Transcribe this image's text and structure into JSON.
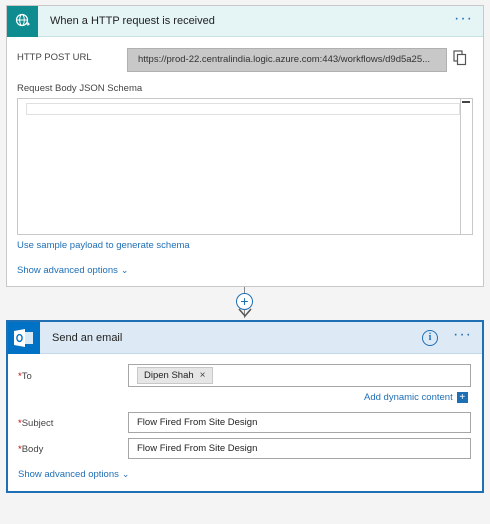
{
  "http_card": {
    "title": "When a HTTP request is received",
    "post_url_label": "HTTP POST URL",
    "post_url_value": "https://prod-22.centralindia.logic.azure.com:443/workflows/d9d5a25...",
    "schema_label": "Request Body JSON Schema",
    "sample_payload_link": "Use sample payload to generate schema",
    "advanced_options_link": "Show advanced options",
    "more_menu": "···"
  },
  "connector": {
    "add_symbol": "+"
  },
  "email_card": {
    "title": "Send an email",
    "more_menu": "···",
    "info_symbol": "i",
    "to_label": "To",
    "to_token": "Dipen Shah",
    "token_remove": "×",
    "dynamic_content_link": "Add dynamic content",
    "dynamic_plus": "+",
    "subject_label": "Subject",
    "subject_value": "Flow Fired From Site Design",
    "body_label": "Body",
    "body_value": "Flow Fired From Site Design",
    "advanced_options_link": "Show advanced options",
    "required_marker": "*"
  },
  "colors": {
    "http_accent": "#0f8c90",
    "outlook_accent": "#0072c6",
    "link_blue": "#1f6fb5",
    "required_red": "#cc0000"
  },
  "icons": [
    "globe-request-icon",
    "copy-icon",
    "chevron-down-icon",
    "add-step-icon",
    "arrow-down-icon",
    "outlook-icon",
    "info-icon",
    "more-options-icon"
  ]
}
